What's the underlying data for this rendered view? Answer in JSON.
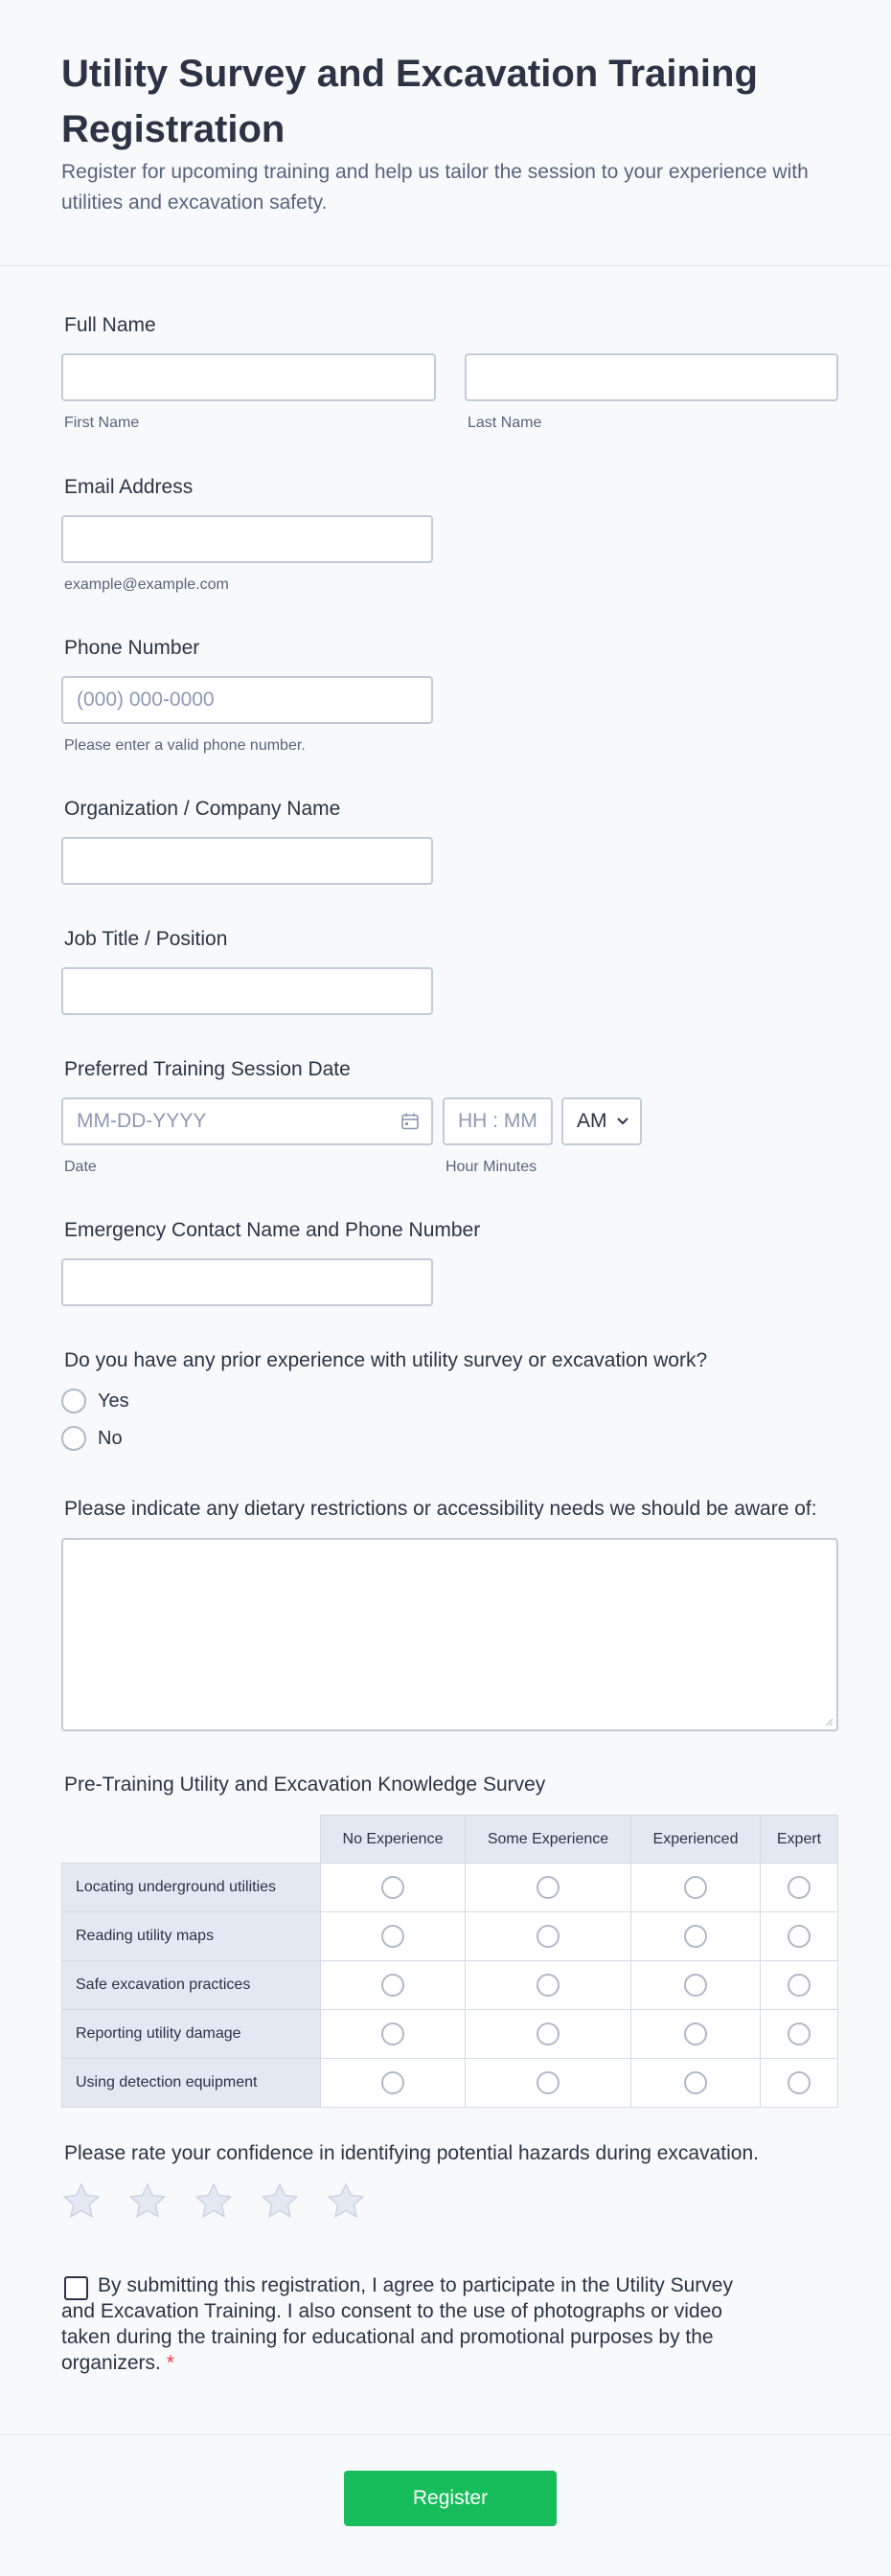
{
  "header": {
    "title": "Utility Survey and Excavation Training Registration",
    "subtitle": "Register for upcoming training and help us tailor the session to your experience with utilities and excavation safety."
  },
  "full_name": {
    "label": "Full Name",
    "first_sublabel": "First Name",
    "last_sublabel": "Last Name",
    "first_value": "",
    "last_value": ""
  },
  "email": {
    "label": "Email Address",
    "sublabel": "example@example.com",
    "value": ""
  },
  "phone": {
    "label": "Phone Number",
    "placeholder": "(000) 000-0000",
    "sublabel": "Please enter a valid phone number."
  },
  "organization": {
    "label": "Organization / Company Name",
    "value": ""
  },
  "job_title": {
    "label": "Job Title / Position",
    "value": ""
  },
  "session": {
    "label": "Preferred Training Session Date",
    "date_placeholder": "MM-DD-YYYY",
    "date_sublabel": "Date",
    "time_placeholder": "HH : MM",
    "time_sublabel": "Hour Minutes",
    "ampm_value": "AM",
    "icons": {
      "calendar": "calendar-icon",
      "dropdown": "chevron-down-icon"
    }
  },
  "emergency": {
    "label": "Emergency Contact Name and Phone Number",
    "value": ""
  },
  "experience": {
    "question": "Do you have any prior experience with utility survey or excavation work?",
    "options": [
      "Yes",
      "No"
    ],
    "selected": null
  },
  "dietary": {
    "label": "Please indicate any dietary restrictions or accessibility needs we should be aware of:",
    "value": ""
  },
  "survey": {
    "title": "Pre-Training Utility and Excavation Knowledge Survey",
    "columns": [
      "No Experience",
      "Some Experience",
      "Experienced",
      "Expert"
    ],
    "rows": [
      "Locating underground utilities",
      "Reading utility maps",
      "Safe excavation practices",
      "Reporting utility damage",
      "Using detection equipment"
    ]
  },
  "rating": {
    "question": "Please rate your confidence in identifying potential hazards during excavation.",
    "max": 5,
    "value": 0,
    "icon": "star-icon"
  },
  "consent": {
    "text": "By submitting this registration, I agree to participate in the Utility Survey and Excavation Training. I also consent to the use of photographs or video taken during the training for educational and promotional purposes by the organizers.",
    "required_mark": "*",
    "checked": false
  },
  "submit": {
    "label": "Register"
  },
  "colors": {
    "accent": "#18bd5b",
    "text": "#2c3345",
    "muted": "#57647e",
    "border": "#c3cad8",
    "required": "#f23a3c",
    "matrix_header": "#e4e8f3"
  }
}
